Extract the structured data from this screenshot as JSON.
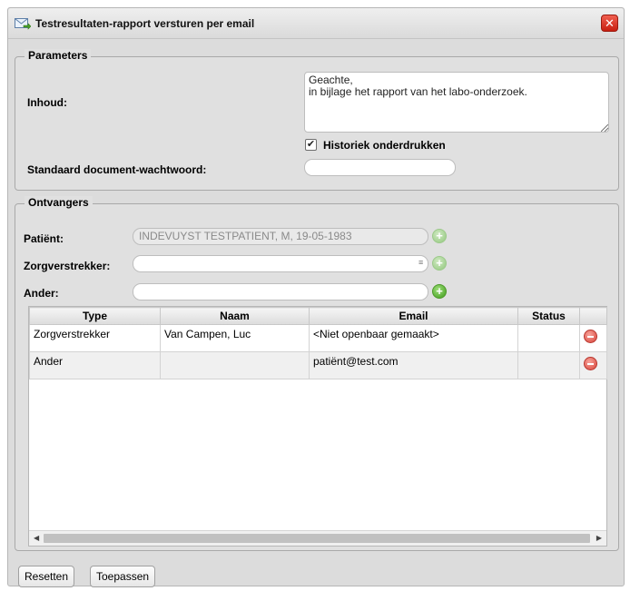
{
  "dialog": {
    "title": "Testresultaten-rapport versturen per email",
    "title_icon": "email-send-icon",
    "close_icon": "close-icon",
    "close_glyph": "✕"
  },
  "parameters": {
    "legend": "Parameters",
    "inhoud_label": "Inhoud:",
    "inhoud_value": "Geachte,\nin bijlage het rapport van het labo-onderzoek.",
    "historiek_label": "Historiek onderdrukken",
    "historiek_checked": true,
    "wachtwoord_label": "Standaard document-wachtwoord:",
    "wachtwoord_value": ""
  },
  "ontvangers": {
    "legend": "Ontvangers",
    "patient_label": "Patiënt:",
    "patient_value": "INDEVUYST TESTPATIENT, M, 19-05-1983",
    "zorgverstrekker_label": "Zorgverstrekker:",
    "zorgverstrekker_value": "",
    "ander_label": "Ander:",
    "ander_value": "",
    "add_glyph": "+"
  },
  "table": {
    "columns": [
      "Type",
      "Naam",
      "Email",
      "Status",
      ""
    ],
    "rows": [
      {
        "type": "Zorgverstrekker",
        "naam": "Van Campen, Luc",
        "email": "<Niet openbaar gemaakt>",
        "status": ""
      },
      {
        "type": "Ander",
        "naam": "",
        "email": "patiënt@test.com",
        "status": ""
      }
    ]
  },
  "footer": {
    "reset_label": "Resetten",
    "apply_label": "Toepassen"
  },
  "colors": {
    "dialog_bg": "#dcdcdc",
    "close_red": "#d9281a",
    "add_green": "#3e9a1a",
    "remove_red": "#d9443a"
  }
}
